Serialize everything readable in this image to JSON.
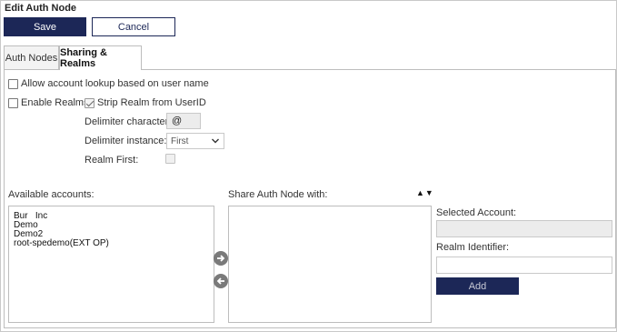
{
  "page": {
    "title": "Edit Auth Node"
  },
  "toolbar": {
    "save_label": "Save",
    "cancel_label": "Cancel"
  },
  "tabs": [
    {
      "label": "Auth Nodes",
      "active": false
    },
    {
      "label": "Sharing & Realms",
      "active": true
    }
  ],
  "options": {
    "allow_lookup": {
      "label": "Allow account lookup based on user name",
      "checked": false
    },
    "enable_realms": {
      "label": "Enable Realms",
      "checked": false
    },
    "strip_realm": {
      "label": "Strip Realm from UserID",
      "checked": true
    },
    "delimiter_character": {
      "label": "Delimiter character:",
      "value": "@"
    },
    "delimiter_instance": {
      "label": "Delimiter instance:",
      "value": "First"
    },
    "realm_first": {
      "label": "Realm First:",
      "checked": false
    }
  },
  "available_accounts": {
    "label": "Available accounts:",
    "items": [
      "Bur   Inc",
      "Demo",
      "Demo2",
      "root-spedemo(EXT OP)"
    ]
  },
  "share_with": {
    "label": "Share Auth Node with:",
    "items": []
  },
  "selected_account": {
    "label": "Selected Account:",
    "value": ""
  },
  "realm_identifier": {
    "label": "Realm Identifier:",
    "value": ""
  },
  "add_label": "Add",
  "icons": {
    "move_right": "arrow-right-circle-icon",
    "move_left": "arrow-left-circle-icon",
    "sort_up": "triangle-up-icon",
    "sort_down": "triangle-down-icon"
  },
  "colors": {
    "brand": "#1c2757",
    "border": "#bdbdbd"
  }
}
